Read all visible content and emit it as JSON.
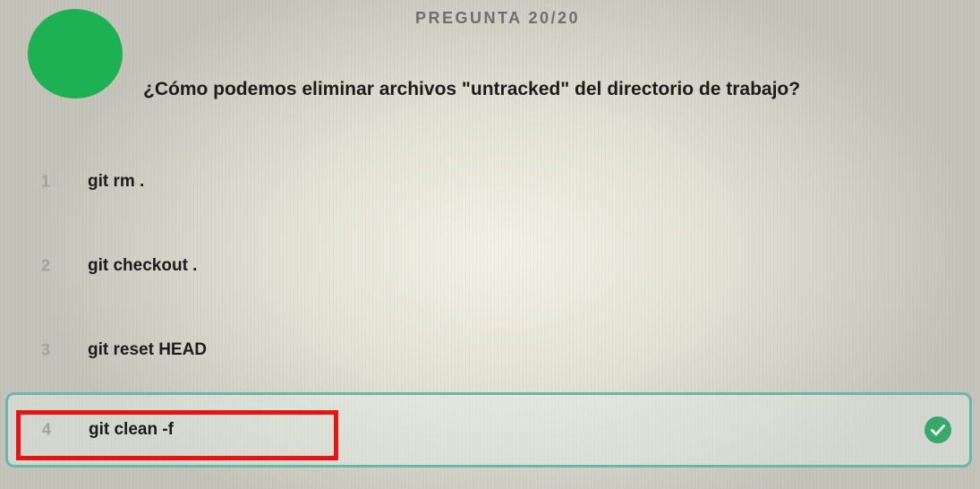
{
  "quiz": {
    "counter": "PREGUNTA 20/20",
    "question": "¿Cómo podemos eliminar archivos \"untracked\" del directorio de trabajo?",
    "options": [
      {
        "number": "1",
        "text": "git rm ."
      },
      {
        "number": "2",
        "text": "git checkout ."
      },
      {
        "number": "3",
        "text": "git reset HEAD"
      },
      {
        "number": "4",
        "text": "git clean -f"
      }
    ],
    "selected_option": "4"
  },
  "colors": {
    "avatar": "#1db153",
    "correct_border": "#6ab6ad",
    "check": "#3aa76a",
    "annotation_box": "#e81313"
  },
  "icons": {
    "avatar": "green-circle-avatar",
    "correct_mark": "check-circle-icon"
  }
}
